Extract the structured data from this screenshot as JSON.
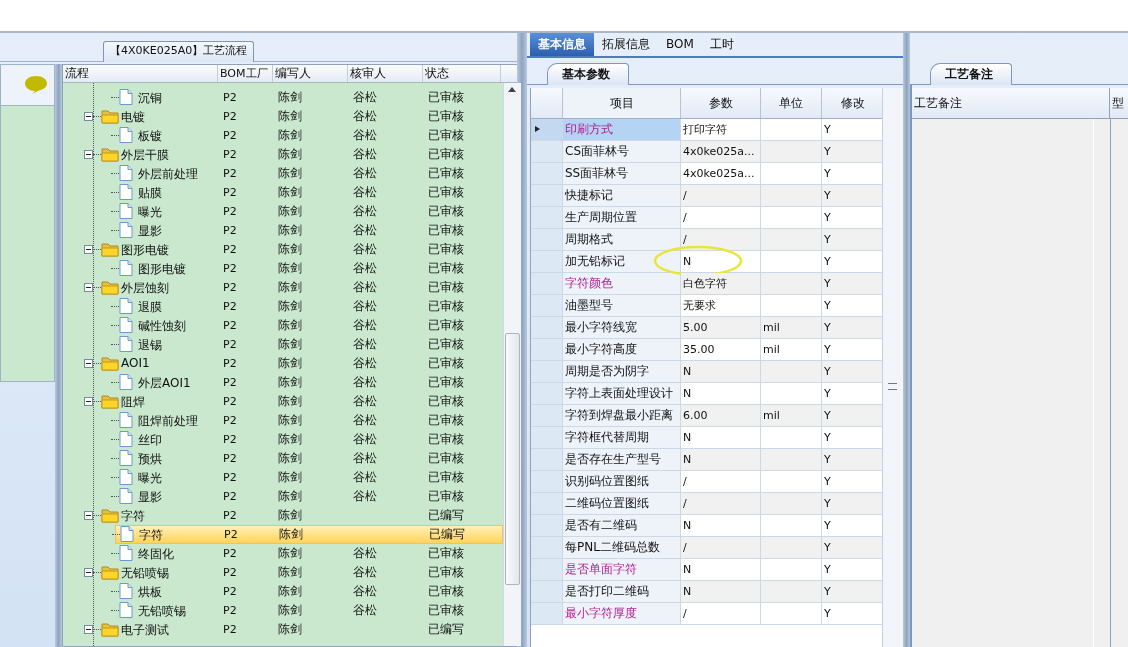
{
  "process_group": {
    "title": "【4X0KE025A0】工艺流程"
  },
  "tree": {
    "columns": [
      "流程",
      "BOM工厂",
      "编写人",
      "核审人",
      "状态"
    ],
    "nodes": [
      {
        "children": [
          {
            "label": "沉铜",
            "factory": "P2",
            "author": "陈剑",
            "reviewer": "谷松",
            "status": "已审核",
            "selected": false
          }
        ]
      },
      {
        "label": "电镀",
        "expanded": true,
        "factory": "P2",
        "author": "陈剑",
        "reviewer": "谷松",
        "status": "已审核",
        "selected": false,
        "children": [
          {
            "label": "板镀",
            "factory": "P2",
            "author": "陈剑",
            "reviewer": "谷松",
            "status": "已审核",
            "selected": false
          }
        ]
      },
      {
        "label": "外层干膜",
        "expanded": true,
        "factory": "P2",
        "author": "陈剑",
        "reviewer": "谷松",
        "status": "已审核",
        "selected": false,
        "children": [
          {
            "label": "外层前处理",
            "factory": "P2",
            "author": "陈剑",
            "reviewer": "谷松",
            "status": "已审核",
            "selected": false
          },
          {
            "label": "贴膜",
            "factory": "P2",
            "author": "陈剑",
            "reviewer": "谷松",
            "status": "已审核",
            "selected": false
          },
          {
            "label": "曝光",
            "factory": "P2",
            "author": "陈剑",
            "reviewer": "谷松",
            "status": "已审核",
            "selected": false
          },
          {
            "label": "显影",
            "factory": "P2",
            "author": "陈剑",
            "reviewer": "谷松",
            "status": "已审核",
            "selected": false
          }
        ]
      },
      {
        "label": "图形电镀",
        "expanded": true,
        "factory": "P2",
        "author": "陈剑",
        "reviewer": "谷松",
        "status": "已审核",
        "selected": false,
        "children": [
          {
            "label": "图形电镀",
            "factory": "P2",
            "author": "陈剑",
            "reviewer": "谷松",
            "status": "已审核",
            "selected": false
          }
        ]
      },
      {
        "label": "外层蚀刻",
        "expanded": true,
        "factory": "P2",
        "author": "陈剑",
        "reviewer": "谷松",
        "status": "已审核",
        "selected": false,
        "children": [
          {
            "label": "退膜",
            "factory": "P2",
            "author": "陈剑",
            "reviewer": "谷松",
            "status": "已审核",
            "selected": false
          },
          {
            "label": "碱性蚀刻",
            "factory": "P2",
            "author": "陈剑",
            "reviewer": "谷松",
            "status": "已审核",
            "selected": false
          },
          {
            "label": "退锡",
            "factory": "P2",
            "author": "陈剑",
            "reviewer": "谷松",
            "status": "已审核",
            "selected": false
          }
        ]
      },
      {
        "label": "AOI1",
        "expanded": true,
        "factory": "P2",
        "author": "陈剑",
        "reviewer": "谷松",
        "status": "已审核",
        "selected": false,
        "children": [
          {
            "label": "外层AOI1",
            "factory": "P2",
            "author": "陈剑",
            "reviewer": "谷松",
            "status": "已审核",
            "selected": false
          }
        ]
      },
      {
        "label": "阻焊",
        "expanded": true,
        "factory": "P2",
        "author": "陈剑",
        "reviewer": "谷松",
        "status": "已审核",
        "selected": false,
        "children": [
          {
            "label": "阻焊前处理",
            "factory": "P2",
            "author": "陈剑",
            "reviewer": "谷松",
            "status": "已审核",
            "selected": false
          },
          {
            "label": "丝印",
            "factory": "P2",
            "author": "陈剑",
            "reviewer": "谷松",
            "status": "已审核",
            "selected": false
          },
          {
            "label": "预烘",
            "factory": "P2",
            "author": "陈剑",
            "reviewer": "谷松",
            "status": "已审核",
            "selected": false
          },
          {
            "label": "曝光",
            "factory": "P2",
            "author": "陈剑",
            "reviewer": "谷松",
            "status": "已审核",
            "selected": false
          },
          {
            "label": "显影",
            "factory": "P2",
            "author": "陈剑",
            "reviewer": "谷松",
            "status": "已审核",
            "selected": false
          }
        ]
      },
      {
        "label": "字符",
        "expanded": true,
        "factory": "P2",
        "author": "陈剑",
        "status": "已编写",
        "selected": false,
        "children": [
          {
            "label": "字符",
            "factory": "P2",
            "author": "陈剑",
            "status": "已编写",
            "selected": true
          },
          {
            "label": "终固化",
            "factory": "P2",
            "author": "陈剑",
            "reviewer": "谷松",
            "status": "已审核",
            "selected": false
          }
        ]
      },
      {
        "label": "无铅喷锡",
        "expanded": true,
        "factory": "P2",
        "author": "陈剑",
        "reviewer": "谷松",
        "status": "已审核",
        "selected": false,
        "children": [
          {
            "label": "烘板",
            "factory": "P2",
            "author": "陈剑",
            "reviewer": "谷松",
            "status": "已审核",
            "selected": false
          },
          {
            "label": "无铅喷锡",
            "factory": "P2",
            "author": "陈剑",
            "reviewer": "谷松",
            "status": "已审核",
            "selected": false
          }
        ]
      },
      {
        "label": "电子测试",
        "expanded": true,
        "factory": "P2",
        "author": "陈剑",
        "status": "已编写",
        "selected": false
      }
    ]
  },
  "tabs": [
    {
      "label": "基本信息",
      "selected": true
    },
    {
      "label": "拓展信息",
      "selected": false
    },
    {
      "label": "BOM",
      "selected": false
    },
    {
      "label": "工时",
      "selected": false
    }
  ],
  "params": {
    "tab": "基本参数",
    "columns": [
      "项目",
      "参数",
      "单位",
      "修改"
    ],
    "rows": [
      {
        "item": "印刷方式",
        "value": "打印字符",
        "modified": "Y",
        "emphasis": true,
        "selected": true,
        "circled": false
      },
      {
        "item": "CS面菲林号",
        "value": "4x0ke025a...",
        "modified": "Y",
        "emphasis": false,
        "selected": false,
        "circled": false
      },
      {
        "item": "SS面菲林号",
        "value": "4x0ke025a...",
        "modified": "Y",
        "emphasis": false,
        "selected": false,
        "circled": false
      },
      {
        "item": "快捷标记",
        "value": "/",
        "modified": "Y",
        "emphasis": false,
        "selected": false,
        "circled": false
      },
      {
        "item": "生产周期位置",
        "value": "/",
        "modified": "Y",
        "emphasis": false,
        "selected": false,
        "circled": false
      },
      {
        "item": "周期格式",
        "value": "/",
        "modified": "Y",
        "emphasis": false,
        "selected": false,
        "circled": false
      },
      {
        "item": "加无铅标记",
        "value": "N",
        "modified": "Y",
        "emphasis": false,
        "selected": false,
        "circled": true
      },
      {
        "item": "字符颜色",
        "value": "白色字符",
        "modified": "Y",
        "emphasis": true,
        "selected": false,
        "circled": false
      },
      {
        "item": "油墨型号",
        "value": "无要求",
        "modified": "Y",
        "emphasis": false,
        "selected": false,
        "circled": false
      },
      {
        "item": "最小字符线宽",
        "value": "5.00",
        "unit": "mil",
        "modified": "Y",
        "emphasis": false,
        "selected": false,
        "circled": false
      },
      {
        "item": "最小字符高度",
        "value": "35.00",
        "unit": "mil",
        "modified": "Y",
        "emphasis": false,
        "selected": false,
        "circled": false
      },
      {
        "item": "周期是否为阴字",
        "value": "N",
        "modified": "Y",
        "emphasis": false,
        "selected": false,
        "circled": false
      },
      {
        "item": "字符上表面处理设计",
        "value": "N",
        "modified": "Y",
        "emphasis": false,
        "selected": false,
        "circled": false
      },
      {
        "item": "字符到焊盘最小距离",
        "value": "6.00",
        "unit": "mil",
        "modified": "Y",
        "emphasis": false,
        "selected": false,
        "circled": false
      },
      {
        "item": "字符框代替周期",
        "value": "N",
        "modified": "Y",
        "emphasis": false,
        "selected": false,
        "circled": false
      },
      {
        "item": "是否存在生产型号",
        "value": "N",
        "modified": "Y",
        "emphasis": false,
        "selected": false,
        "circled": false
      },
      {
        "item": "识别码位置图纸",
        "value": "/",
        "modified": "Y",
        "emphasis": false,
        "selected": false,
        "circled": false
      },
      {
        "item": "二维码位置图纸",
        "value": "/",
        "modified": "Y",
        "emphasis": false,
        "selected": false,
        "circled": false
      },
      {
        "item": "是否有二维码",
        "value": "N",
        "modified": "Y",
        "emphasis": false,
        "selected": false,
        "circled": false
      },
      {
        "item": "每PNL二维码总数",
        "value": "/",
        "modified": "Y",
        "emphasis": false,
        "selected": false,
        "circled": false
      },
      {
        "item": "是否单面字符",
        "value": "N",
        "modified": "Y",
        "emphasis": true,
        "selected": false,
        "circled": false
      },
      {
        "item": "是否打印二维码",
        "value": "N",
        "modified": "Y",
        "emphasis": false,
        "selected": false,
        "circled": false
      },
      {
        "item": "最小字符厚度",
        "value": "/",
        "modified": "Y",
        "emphasis": true,
        "selected": false,
        "circled": false
      }
    ]
  },
  "notes": {
    "tab": "工艺备注",
    "columns": [
      "工艺备注",
      "型"
    ]
  }
}
